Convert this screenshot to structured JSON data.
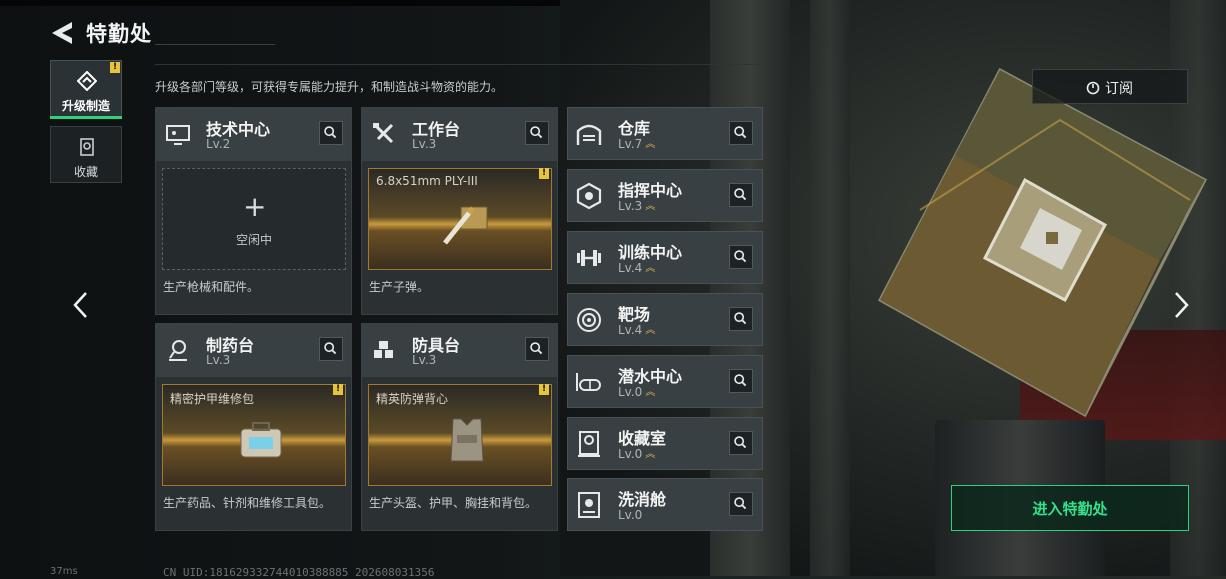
{
  "header": {
    "title": "特勤处"
  },
  "description": "升级各部门等级，可获得专属能力提升，和制造战斗物资的能力。",
  "tabs": [
    {
      "label": "升级制造",
      "icon": "upgrade-craft-icon",
      "active": true,
      "badge": "!"
    },
    {
      "label": "收藏",
      "icon": "collection-icon",
      "active": false
    }
  ],
  "main_cards": [
    {
      "name": "技术中心",
      "level": "Lv.2",
      "icon": "tech-center-icon",
      "slot_state": "empty",
      "slot_text": "空闲中",
      "desc": "生产枪械和配件。"
    },
    {
      "name": "工作台",
      "level": "Lv.3",
      "icon": "workbench-icon",
      "slot_state": "item",
      "slot_label": "6.8x51mm PLY-III",
      "desc": "生产子弹。",
      "badge": "!"
    },
    {
      "name": "制药台",
      "level": "Lv.3",
      "icon": "pharmacy-icon",
      "slot_state": "item",
      "slot_label": "精密护甲维修包",
      "desc": "生产药品、针剂和维修工具包。",
      "badge": "!"
    },
    {
      "name": "防具台",
      "level": "Lv.3",
      "icon": "armor-bench-icon",
      "slot_state": "item",
      "slot_label": "精英防弹背心",
      "desc": "生产头盔、护甲、胸挂和背包。",
      "badge": "!"
    }
  ],
  "side_cards": [
    {
      "name": "仓库",
      "level": "Lv.7",
      "icon": "warehouse-icon",
      "upgradable": true
    },
    {
      "name": "指挥中心",
      "level": "Lv.3",
      "icon": "command-center-icon",
      "upgradable": true
    },
    {
      "name": "训练中心",
      "level": "Lv.4",
      "icon": "training-center-icon",
      "upgradable": true
    },
    {
      "name": "靶场",
      "level": "Lv.4",
      "icon": "shooting-range-icon",
      "upgradable": true
    },
    {
      "name": "潜水中心",
      "level": "Lv.0",
      "icon": "diving-center-icon",
      "upgradable": true
    },
    {
      "name": "收藏室",
      "level": "Lv.0",
      "icon": "collection-room-icon",
      "upgradable": true
    },
    {
      "name": "洗消舱",
      "level": "Lv.0",
      "icon": "decon-chamber-icon",
      "upgradable": false
    }
  ],
  "subscribe": {
    "label": "订阅",
    "icon": "subscribe-icon"
  },
  "enter_button": {
    "label": "进入特勤处"
  },
  "footer": {
    "ping": "37ms",
    "uid": "CN UID:181629332744010388885 202608031356"
  },
  "colors": {
    "accent": "#2ed27a",
    "badge": "#e8c43a",
    "upgrade": "#d9b04a",
    "gold_slot": "#c99a3e"
  }
}
